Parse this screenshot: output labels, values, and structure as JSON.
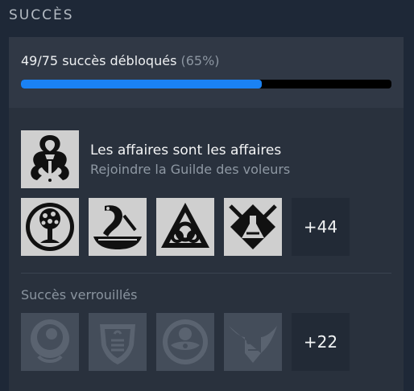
{
  "section": {
    "title": "SUCCÈS"
  },
  "progress": {
    "unlocked": "49/75 succès débloqués",
    "percent_label": "(65%)",
    "fraction": 0.65,
    "fill_color": "#1a82f4"
  },
  "featured": {
    "name": "Les affaires sont les affaires",
    "description": "Rejoindre la Guilde des voleurs",
    "icon": "thieves-guild-knot-icon"
  },
  "unlocked_icons": [
    "tree-emblem-icon",
    "serpent-ship-icon",
    "triquetra-knot-icon",
    "alchemy-tools-icon"
  ],
  "unlocked_more": "+44",
  "locked": {
    "title": "Succès verrouillés",
    "icons": [
      "portrait-knot-icon",
      "shield-fire-icon",
      "eye-emblem-icon",
      "dwarven-face-icon"
    ],
    "more": "+22"
  }
}
